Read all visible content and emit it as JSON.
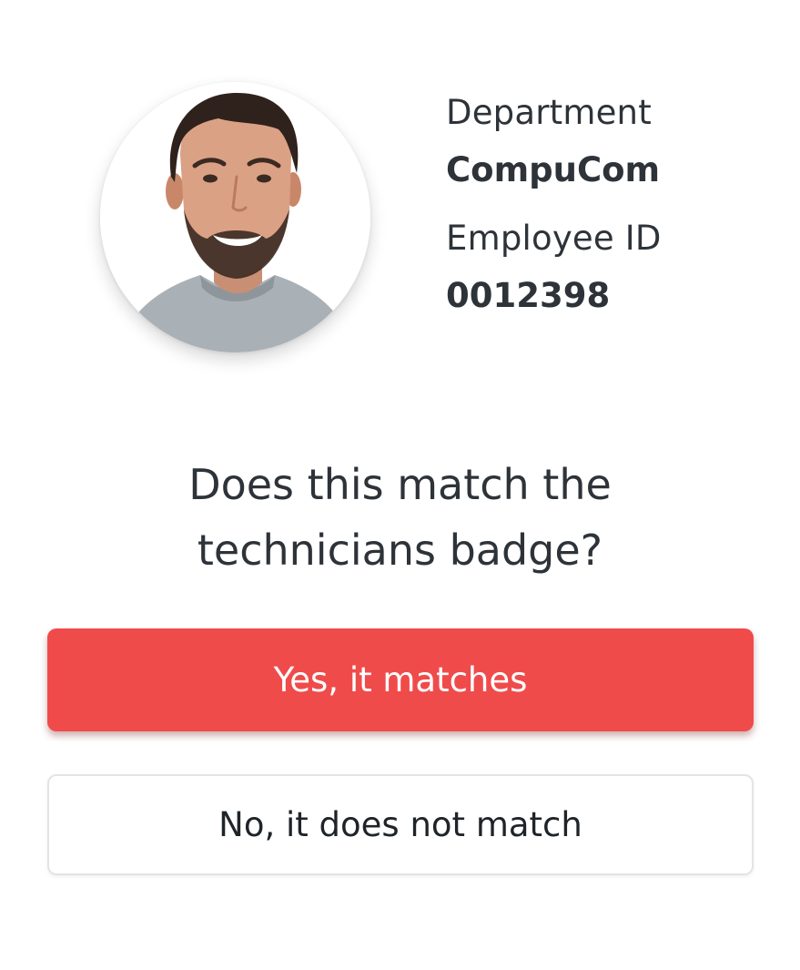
{
  "profile": {
    "photo": "technician-portrait",
    "department_label": "Department",
    "department_value": "CompuCom",
    "employee_id_label": "Employee ID",
    "employee_id_value": "0012398"
  },
  "prompt": {
    "question_line1": "Does this match the",
    "question_line2": "technicians badge?"
  },
  "actions": {
    "confirm_label": "Yes, it matches",
    "reject_label": "No, it does not match"
  },
  "colors": {
    "accent": "#f04b4b",
    "text": "#2d3339",
    "background": "#ffffff"
  }
}
